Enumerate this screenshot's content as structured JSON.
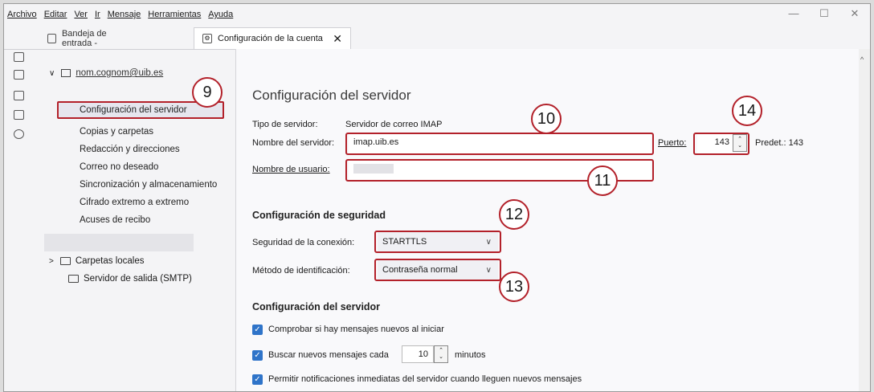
{
  "menubar": [
    "Archivo",
    "Editar",
    "Ver",
    "Ir",
    "Mensaje",
    "Herramientas",
    "Ayuda"
  ],
  "window_controls": {
    "minimize": "—",
    "maximize": "☐",
    "close": "✕"
  },
  "tabs": {
    "inbox": "Bandeja de entrada -",
    "account_settings": "Configuración de la cuenta",
    "close_glyph": "✕"
  },
  "sidebar": {
    "account_name": "nom.cognom@uib.es",
    "items": [
      "Configuración del servidor",
      "Copias y carpetas",
      "Redacción y direcciones",
      "Correo no deseado",
      "Sincronización y almacenamiento",
      "Cifrado extremo a extremo",
      "Acuses de recibo"
    ],
    "local_folders": "Carpetas locales",
    "smtp": "Servidor de salida (SMTP)"
  },
  "server": {
    "heading": "Configuración del servidor",
    "type_label": "Tipo de servidor:",
    "type_value": "Servidor de correo IMAP",
    "server_name_label": "Nombre del servidor:",
    "server_name_value": "imap.uib.es",
    "port_label": "Puerto:",
    "port_value": "143",
    "default_port": "Predet.: 143",
    "username_label": "Nombre de usuario:"
  },
  "security": {
    "heading": "Configuración de seguridad",
    "connection_label": "Seguridad de la conexión:",
    "connection_value": "STARTTLS",
    "auth_label": "Método de identificación:",
    "auth_value": "Contraseña normal"
  },
  "server_options": {
    "heading": "Configuración del servidor",
    "check_on_start": "Comprobar si hay mensajes nuevos al iniciar",
    "check_every_prefix": "Buscar nuevos mensajes cada",
    "check_every_value": "10",
    "check_every_suffix": "minutos",
    "push_notifications": "Permitir notificaciones inmediatas del servidor cuando lleguen nuevos mensajes"
  },
  "callouts": {
    "c9": "9",
    "c10": "10",
    "c11": "11",
    "c12": "12",
    "c13": "13",
    "c14": "14"
  },
  "colors": {
    "highlight": "#b3212a",
    "checkbox": "#2f74c9"
  }
}
